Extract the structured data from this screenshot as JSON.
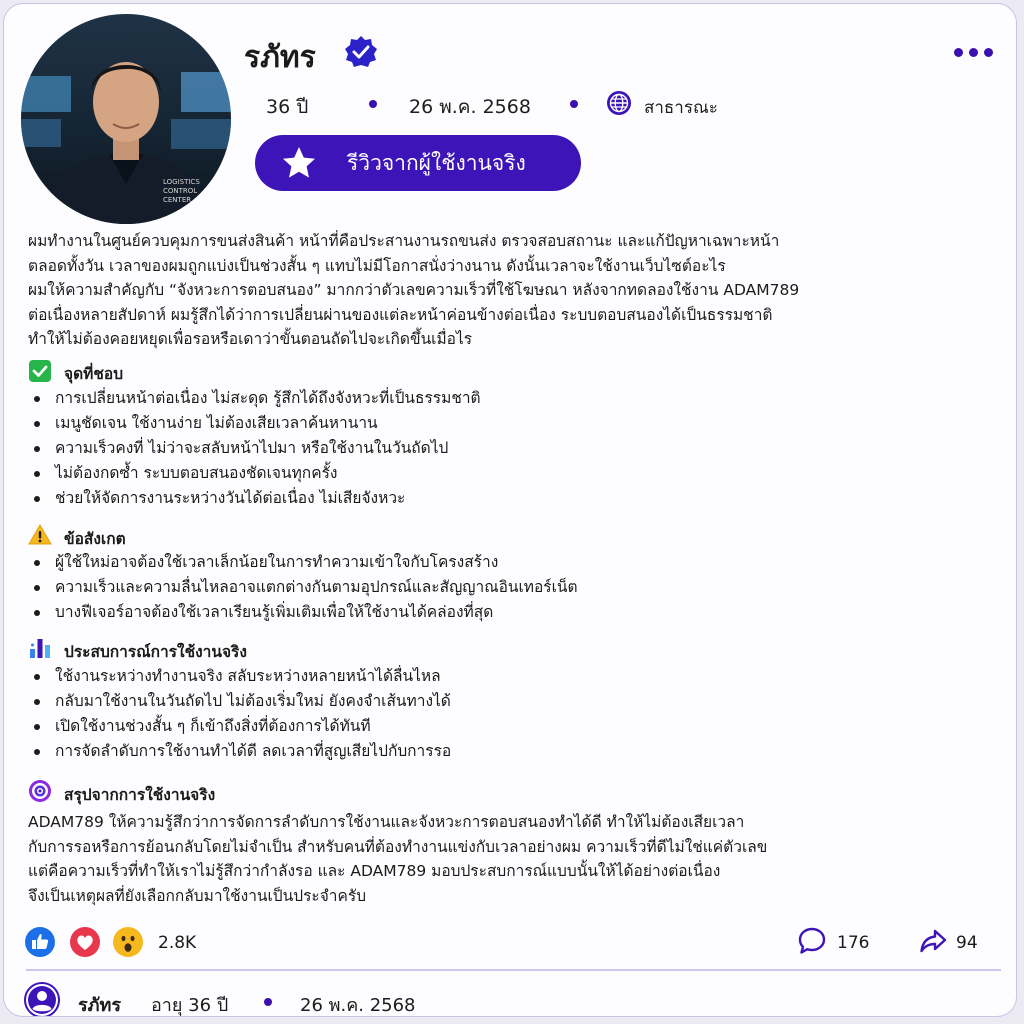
{
  "profile": {
    "name": "รภัทร",
    "age": "36 ปี",
    "date": "26 พ.ค. 2568",
    "visibility": "สาธารณะ",
    "avatar_badge_lines": [
      "LOGISTICS",
      "CONTROL",
      "CENTER"
    ]
  },
  "review_button": {
    "label": "รีวิวจากผู้ใช้งานจริง",
    "icon": "star-icon"
  },
  "intro": [
    "ผมทำงานในศูนย์ควบคุมการขนส่งสินค้า หน้าที่คือประสานงานรถขนส่ง ตรวจสอบสถานะ และแก้ปัญหาเฉพาะหน้า",
    "ตลอดทั้งวัน เวลาของผมถูกแบ่งเป็นช่วงสั้น ๆ แทบไม่มีโอกาสนั่งว่างนาน ดังนั้นเวลาจะใช้งานเว็บไซต์อะไร",
    "ผมให้ความสำคัญกับ “จังหวะการตอบสนอง” มากกว่าตัวเลขความเร็วที่ใช้โฆษณา หลังจากทดลองใช้งาน ADAM789",
    "ต่อเนื่องหลายสัปดาห์ ผมรู้สึกได้ว่าการเปลี่ยนผ่านของแต่ละหน้าค่อนข้างต่อเนื่อง ระบบตอบสนองได้เป็นธรรมชาติ",
    "ทำให้ไม่ต้องคอยหยุดเพื่อรอหรือเดาว่าขั้นตอนถัดไปจะเกิดขึ้นเมื่อไร"
  ],
  "sections": {
    "likes": {
      "title": "จุดที่ชอบ",
      "icon": "check-icon",
      "items": [
        "การเปลี่ยนหน้าต่อเนื่อง ไม่สะดุด รู้สึกได้ถึงจังหวะที่เป็นธรรมชาติ",
        "เมนูชัดเจน ใช้งานง่าย ไม่ต้องเสียเวลาค้นหานาน",
        "ความเร็วคงที่ ไม่ว่าจะสลับหน้าไปมา หรือใช้งานในวันถัดไป",
        "ไม่ต้องกดซ้ำ ระบบตอบสนองชัดเจนทุกครั้ง",
        "ช่วยให้จัดการงานระหว่างวันได้ต่อเนื่อง ไม่เสียจังหวะ"
      ]
    },
    "notes": {
      "title": "ข้อสังเกต",
      "icon": "warning-icon",
      "items": [
        "ผู้ใช้ใหม่อาจต้องใช้เวลาเล็กน้อยในการทำความเข้าใจกับโครงสร้าง",
        "ความเร็วและความลื่นไหลอาจแตกต่างกันตามอุปกรณ์และสัญญาณอินเทอร์เน็ต",
        "บางฟีเจอร์อาจต้องใช้เวลาเรียนรู้เพิ่มเติมเพื่อให้ใช้งานได้คล่องที่สุด"
      ]
    },
    "experience": {
      "title": "ประสบการณ์การใช้งานจริง",
      "icon": "bar-chart-icon",
      "items": [
        "ใช้งานระหว่างทำงานจริง สลับระหว่างหลายหน้าได้ลื่นไหล",
        "กลับมาใช้งานในวันถัดไป ไม่ต้องเริ่มใหม่ ยังคงจำเส้นทางได้",
        "เปิดใช้งานช่วงสั้น ๆ ก็เข้าถึงสิ่งที่ต้องการได้ทันที",
        "การจัดลำดับการใช้งานทำได้ดี ลดเวลาที่สูญเสียไปกับการรอ"
      ]
    },
    "summary": {
      "title": "สรุปจากการใช้งานจริง",
      "icon": "target-icon",
      "lines": [
        "ADAM789 ให้ความรู้สึกว่าการจัดการลำดับการใช้งานและจังหวะการตอบสนองทำได้ดี ทำให้ไม่ต้องเสียเวลา",
        "กับการรอหรือการย้อนกลับโดยไม่จำเป็น สำหรับคนที่ต้องทำงานแข่งกับเวลาอย่างผม ความเร็วที่ดีไม่ใช่แค่ตัวเลข",
        "แต่คือความเร็วที่ทำให้เราไม่รู้สึกว่ากำลังรอ และ ADAM789 มอบประสบการณ์แบบนั้นให้ได้อย่างต่อเนื่อง",
        "จึงเป็นเหตุผลที่ยังเลือกกลับมาใช้งานเป็นประจำครับ"
      ]
    }
  },
  "reactions": {
    "icons": [
      "like-icon",
      "love-icon",
      "wow-icon"
    ],
    "count": "2.8K",
    "comments": "176",
    "shares": "94",
    "colors": {
      "like": "#1d6fe8",
      "love": "#e8374d",
      "wow": "#f6b81f",
      "accent": "#3d14b8"
    }
  },
  "footer": {
    "name": "รภัทร",
    "age_label": "อายุ 36 ปี",
    "date": "26 พ.ค. 2568"
  }
}
